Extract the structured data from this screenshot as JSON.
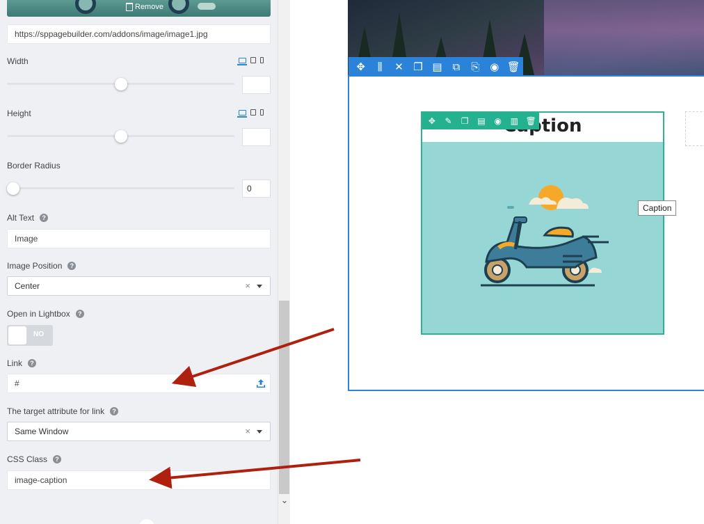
{
  "settings": {
    "image_thumb": {
      "remove_label": "Remove"
    },
    "image_url": "https://sppagebuilder.com/addons/image/image1.jpg",
    "width": {
      "label": "Width",
      "value": ""
    },
    "height": {
      "label": "Height",
      "value": ""
    },
    "border_radius": {
      "label": "Border Radius",
      "value": "0"
    },
    "alt_text": {
      "label": "Alt Text",
      "value": "Image"
    },
    "image_position": {
      "label": "Image Position",
      "selected": "Center"
    },
    "lightbox": {
      "label": "Open in Lightbox",
      "toggle_text": "NO",
      "on": false
    },
    "link": {
      "label": "Link",
      "value": "#"
    },
    "target": {
      "label": "The target attribute for link",
      "selected": "Same Window"
    },
    "css_class": {
      "label": "CSS Class",
      "value": "image-caption"
    },
    "help_glyph": "?",
    "clear_glyph": "×",
    "scroll_down_glyph": "⌄"
  },
  "preview": {
    "caption_title": "Caption",
    "tooltip": "Caption"
  },
  "colors": {
    "accent_blue": "#2b82d9",
    "addon_green": "#24b18f",
    "image_bg": "#96d6d5",
    "arrow_red": "#b0200f"
  },
  "icons": {
    "row_toolbar": [
      "move-icon",
      "columns-icon",
      "tools-icon",
      "duplicate-icon",
      "save-icon",
      "copy-icon",
      "paste-icon",
      "visibility-icon",
      "trash-icon"
    ],
    "addon_toolbar": [
      "move-icon",
      "edit-icon",
      "duplicate-icon",
      "save-icon",
      "visibility-icon",
      "columns-icon",
      "trash-icon"
    ]
  }
}
